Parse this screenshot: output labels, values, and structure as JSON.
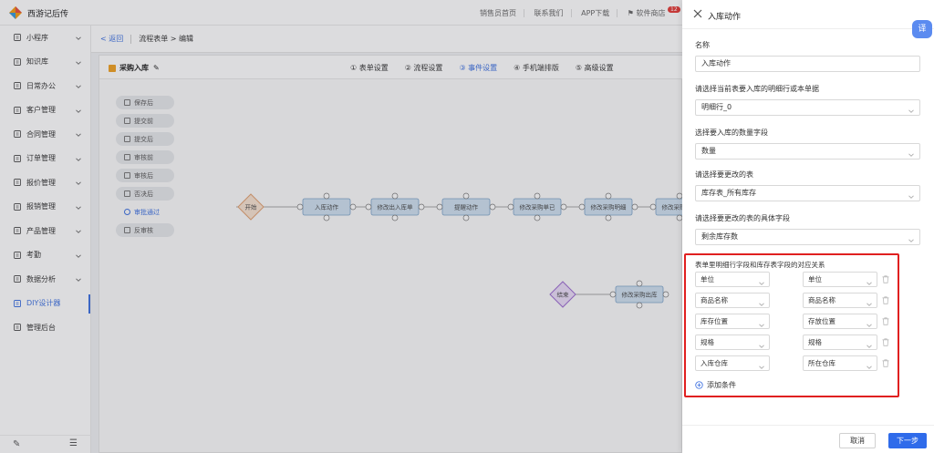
{
  "app": {
    "title": "西游记后传"
  },
  "topbar": {
    "items": [
      "销售员首页",
      "联系我们",
      "APP下载",
      "软件商店"
    ],
    "badge": "12"
  },
  "sidebar": {
    "items": [
      {
        "label": "小程序",
        "icon": "grid-icon",
        "expand": true
      },
      {
        "label": "知识库",
        "icon": "book-icon",
        "expand": true
      },
      {
        "label": "日常办公",
        "icon": "calendar-icon",
        "expand": true
      },
      {
        "label": "客户管理",
        "icon": "customer-icon",
        "expand": true
      },
      {
        "label": "合同管理",
        "icon": "contract-icon",
        "expand": true
      },
      {
        "label": "订单管理",
        "icon": "order-icon",
        "expand": true
      },
      {
        "label": "报价管理",
        "icon": "quote-icon",
        "expand": true
      },
      {
        "label": "报销管理",
        "icon": "reimburse-icon",
        "expand": true
      },
      {
        "label": "产品管理",
        "icon": "product-icon",
        "expand": true
      },
      {
        "label": "考勤",
        "icon": "attendance-icon",
        "expand": true
      },
      {
        "label": "数据分析",
        "icon": "chart-icon",
        "expand": true
      },
      {
        "label": "DIY设计器",
        "icon": "diy-icon",
        "expand": false,
        "active": true
      },
      {
        "label": "管理后台",
        "icon": "admin-icon",
        "expand": false
      }
    ]
  },
  "breadcrumb": {
    "back": "< 返回",
    "path": "流程表单 > 编辑"
  },
  "form": {
    "title": "采购入库",
    "steps": [
      "① 表单设置",
      "② 流程设置",
      "③ 事件设置",
      "④ 手机端排版",
      "⑤ 高级设置"
    ],
    "active_step": 2
  },
  "events": [
    "保存后",
    "提交前",
    "提交后",
    "审核前",
    "审核后",
    "否决后",
    "审批通过",
    "反审核"
  ],
  "active_event": 6,
  "flow": {
    "nodes": [
      "开始",
      "入库动作",
      "修改出入库单",
      "提醒动作",
      "修改采购单已",
      "修改采购明细",
      "结束",
      "修改采购出库"
    ]
  },
  "drawer": {
    "title": "入库动作",
    "translate_btn": "译",
    "fields": [
      {
        "label": "名称",
        "value": "入库动作",
        "select": false
      },
      {
        "label": "请选择当前表要入库的明细行或本单据",
        "value": "明细行_0",
        "select": true
      },
      {
        "label": "选择要入库的数量字段",
        "value": "数量",
        "select": true
      },
      {
        "label": "请选择要更改的表",
        "value": "库存表_所有库存",
        "select": true
      },
      {
        "label": "请选择要更改的表的具体字段",
        "value": "剩余库存数",
        "select": true
      }
    ],
    "mapping_label": "表单里明细行字段和库存表字段的对应关系",
    "mappings": [
      {
        "left": "单位",
        "right": "单位"
      },
      {
        "left": "商品名称",
        "right": "商品名称"
      },
      {
        "left": "库存位置",
        "right": "存放位置"
      },
      {
        "left": "规格",
        "right": "规格"
      },
      {
        "left": "入库仓库",
        "right": "所在仓库"
      }
    ],
    "add_condition": "添加条件",
    "cancel": "取消",
    "next": "下一步"
  }
}
